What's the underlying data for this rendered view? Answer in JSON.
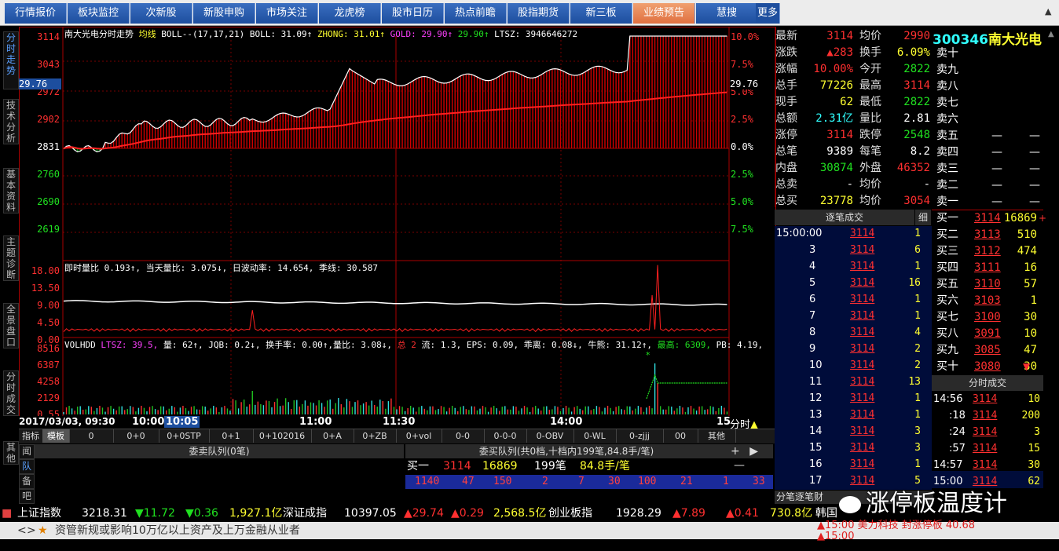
{
  "tabs": [
    "行情报价",
    "板块监控",
    "次新股",
    "新股申购",
    "市场关注",
    "龙虎榜",
    "股市日历",
    "热点前瞻",
    "股指期货",
    "新三板",
    "业绩预告",
    "慧搜",
    "更多"
  ],
  "left_tabs": [
    "分时走势",
    "技术分析",
    "基本资料",
    "主题诊断",
    "全景盘口",
    "分时成交",
    "其他"
  ],
  "chart": {
    "title": "南大光电分时走势",
    "title_extra": "均线",
    "boll": "BOLL--(17,17,21) BOLL: 31.09↑",
    "zhong": "ZHONG: 31.01↑",
    "gold": "GOLD: 29.90↑",
    "gold2": "29.90↑",
    "ltsz": "LTSZ: 3946646272",
    "price_labels": [
      "3114",
      "3043",
      "2972",
      "2902",
      "2831",
      "2760",
      "2690",
      "2619"
    ],
    "pct_labels": [
      "10.0%",
      "7.5%",
      "5.0%",
      "2.5%",
      "0.0%",
      "2.5%",
      "5.0%",
      "7.5%"
    ],
    "cur_left": "29.76",
    "cur_right": "29.76",
    "vol_info": "即时量比 0.193↑, 当天量比: 3.075↓, 日波动率: 14.654, 季线: 30.587",
    "vol_labels": [
      "18.00",
      "13.50",
      "9.00",
      "4.50",
      "0.00"
    ],
    "ind_info_a": "VOLHDD",
    "ind_info_b": "LTSZ: 39.5,",
    "ind_info_c": "量: 62↑, JQB: 0.2↓, 换手率: 0.00↑,量比: 3.08↓,",
    "ind_info_d": "总 2",
    "ind_info_e": "流: 1.3, EPS: 0.09, 乖离: 0.08↓, 牛熊: 31.12↑,",
    "ind_info_f": "最高: 6309,",
    "ind_info_g": "PB: 4.19,",
    "ind_labels": [
      "8516",
      "6387",
      "4258",
      "2129",
      "0.55"
    ],
    "date": "2017/03/03, 09:30",
    "time_labels": [
      "10:00",
      "10:05",
      "11:00",
      "11:30",
      "14:00",
      "15"
    ],
    "mode": "分时",
    "intraday": {
      "open": 2822,
      "close": 3114,
      "prev_close": 2831,
      "high": 3114,
      "low": 2822,
      "peak_vol": 18.0
    }
  },
  "quote": {
    "code": "300346",
    "name": "南大光电",
    "rows": [
      {
        "l1": "最新",
        "v1": "3114",
        "c1": "#ff3030",
        "l2": "均价",
        "v2": "2990",
        "c2": "#ff3030"
      },
      {
        "l1": "涨跌",
        "v1": "▲283",
        "c1": "#ff3030",
        "l2": "换手",
        "v2": "6.09%",
        "c2": "#ffff30"
      },
      {
        "l1": "涨幅",
        "v1": "10.00%",
        "c1": "#ff3030",
        "l2": "今开",
        "v2": "2822",
        "c2": "#20e020"
      },
      {
        "l1": "总手",
        "v1": "77226",
        "c1": "#ffff30",
        "l2": "最高",
        "v2": "3114",
        "c2": "#ff3030"
      },
      {
        "l1": "现手",
        "v1": "62",
        "c1": "#ffff30",
        "l2": "最低",
        "v2": "2822",
        "c2": "#20e020"
      },
      {
        "l1": "总额",
        "v1": "2.31亿",
        "c1": "#30ffff",
        "l2": "量比",
        "v2": "2.81",
        "c2": "#ffffff"
      },
      {
        "l1": "涨停",
        "v1": "3114",
        "c1": "#ff3030",
        "l2": "跌停",
        "v2": "2548",
        "c2": "#20e020"
      },
      {
        "l1": "总笔",
        "v1": "9389",
        "c1": "#ffffff",
        "l2": "每笔",
        "v2": "8.2",
        "c2": "#ffffff"
      },
      {
        "l1": "内盘",
        "v1": "30874",
        "c1": "#20e020",
        "l2": "外盘",
        "v2": "46352",
        "c2": "#ff3030"
      },
      {
        "l1": "总卖",
        "v1": "-",
        "c1": "#ffffff",
        "l2": "均价",
        "v2": "-",
        "c2": "#ffffff"
      },
      {
        "l1": "总买",
        "v1": "23778",
        "c1": "#ffff30",
        "l2": "均价",
        "v2": "3054",
        "c2": "#ff3030"
      }
    ]
  },
  "sells": [
    "卖十",
    "卖九",
    "卖八",
    "卖七",
    "卖六",
    "卖五",
    "卖四",
    "卖三",
    "卖二",
    "卖一"
  ],
  "dash": "—",
  "buys": [
    {
      "l": "买一",
      "p": "3114",
      "v": "16869",
      "m": "+"
    },
    {
      "l": "买二",
      "p": "3113",
      "v": "510",
      "m": ""
    },
    {
      "l": "买三",
      "p": "3112",
      "v": "474",
      "m": ""
    },
    {
      "l": "买四",
      "p": "3111",
      "v": "16",
      "m": ""
    },
    {
      "l": "买五",
      "p": "3110",
      "v": "57",
      "m": ""
    },
    {
      "l": "买六",
      "p": "3103",
      "v": "1",
      "m": ""
    },
    {
      "l": "买七",
      "p": "3100",
      "v": "30",
      "m": ""
    },
    {
      "l": "买八",
      "p": "3091",
      "v": "10",
      "m": ""
    },
    {
      "l": "买九",
      "p": "3085",
      "v": "47",
      "m": ""
    },
    {
      "l": "买十",
      "p": "3080",
      "v": "30",
      "m": "▼"
    }
  ],
  "ticks_header": "逐笔成交",
  "ticks_side": "细",
  "ticks": [
    {
      "t": "15:00:00",
      "p": "3114",
      "v": "1"
    },
    {
      "t": "3",
      "p": "3114",
      "v": "6"
    },
    {
      "t": "4",
      "p": "3114",
      "v": "1"
    },
    {
      "t": "5",
      "p": "3114",
      "v": "16"
    },
    {
      "t": "6",
      "p": "3114",
      "v": "1"
    },
    {
      "t": "7",
      "p": "3114",
      "v": "1"
    },
    {
      "t": "8",
      "p": "3114",
      "v": "4"
    },
    {
      "t": "9",
      "p": "3114",
      "v": "2"
    },
    {
      "t": "10",
      "p": "3114",
      "v": "2"
    },
    {
      "t": "11",
      "p": "3114",
      "v": "13"
    },
    {
      "t": "12",
      "p": "3114",
      "v": "1"
    },
    {
      "t": "13",
      "p": "3114",
      "v": "1"
    },
    {
      "t": "14",
      "p": "3114",
      "v": "3"
    },
    {
      "t": "15",
      "p": "3114",
      "v": "3"
    },
    {
      "t": "16",
      "p": "3114",
      "v": "1"
    },
    {
      "t": "17",
      "p": "3114",
      "v": "5"
    }
  ],
  "fen_header": "分时成交",
  "fen": [
    {
      "t": "14:56",
      "p": "3114",
      "v": "10"
    },
    {
      "t": ":18",
      "p": "3114",
      "v": "200"
    },
    {
      "t": ":24",
      "p": "3114",
      "v": "3"
    },
    {
      "t": ":57",
      "p": "3114",
      "v": "15"
    },
    {
      "t": "14:57",
      "p": "3114",
      "v": "30"
    },
    {
      "t": "15:00",
      "p": "3114",
      "v": "62"
    }
  ],
  "indicators": [
    "指标",
    "模板",
    "0",
    "0+0",
    "0+0STP",
    "0+1",
    "0+102016",
    "0+A",
    "0+ZB",
    "0+vol",
    "0-0",
    "0-0-0",
    "0-OBV",
    "0-WL",
    "0-zjjj",
    "00",
    "其他"
  ],
  "bottom_left": [
    "闻",
    "队",
    "备",
    "吧"
  ],
  "queue": {
    "sell_title": "委卖队列(0笔)",
    "buy_title": "委买队列(共0档,十档内199笔,84.8手/笔)",
    "b1_label": "买一",
    "b1_price": "3114",
    "b1_vol": "16869",
    "b1_count": "199笔",
    "b1_avg": "84.8手/笔",
    "orders": [
      "1140",
      "47",
      "150",
      "2",
      "7",
      "30",
      "100",
      "21",
      "1",
      "33"
    ]
  },
  "ticks_footer": "分笔逐笔财",
  "status": {
    "sh": "上证指数",
    "sh_v": "3218.31",
    "sh_c": "▼11.72",
    "sh_p": "▼0.36",
    "sh_a": "1,927.1亿",
    "sz": "深证成指",
    "sz_v": "10397.05",
    "sz_c": "▲29.74",
    "sz_p": "▲0.29",
    "sz_a": "2,568.5亿",
    "cy": "创业板指",
    "cy_v": "1928.29",
    "cy_c": "▲7.89",
    "cy_p": "▲0.41",
    "cy_a": "730.8亿",
    "kr": "韩国"
  },
  "news": {
    "text": "资管新规或影响10万亿以上资产及上万金融从业者",
    "alert1": "▲15:00 美力科技 封涨停板 40.68",
    "alert2": "▲15:00"
  },
  "watermark": "涨停板温度计"
}
